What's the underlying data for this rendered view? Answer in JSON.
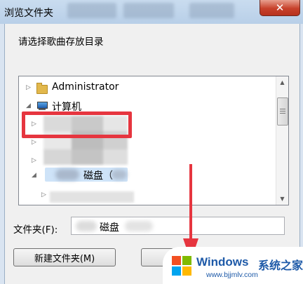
{
  "window": {
    "title": "浏览文件夹",
    "close_glyph": "✕"
  },
  "dialog": {
    "prompt": "请选择歌曲存放目录",
    "tree": {
      "items": [
        {
          "label": "Administrator",
          "icon": "user-folder-icon",
          "expander": "▷"
        },
        {
          "label": "计算机",
          "icon": "computer-icon",
          "expander": "◢"
        },
        {
          "label": "",
          "expander": "▷"
        },
        {
          "label": "",
          "expander": "▷"
        },
        {
          "label": "",
          "expander": "▷"
        },
        {
          "label": "磁盘（",
          "expander": "◢",
          "selected": true
        },
        {
          "label": "",
          "expander": "▷"
        }
      ]
    },
    "folder_field": {
      "label": "文件夹(F):",
      "value": "磁盘"
    },
    "buttons": {
      "new_folder": "新建文件夹(M)",
      "ok": ""
    }
  },
  "watermark": {
    "brand": "Windows",
    "brand_cn": "系统之家",
    "url": "www.bjjmlv.com"
  },
  "colors": {
    "highlight_box": "#e6353f",
    "selection": "#bedaf5",
    "brand_blue": "#1e5aa8"
  }
}
